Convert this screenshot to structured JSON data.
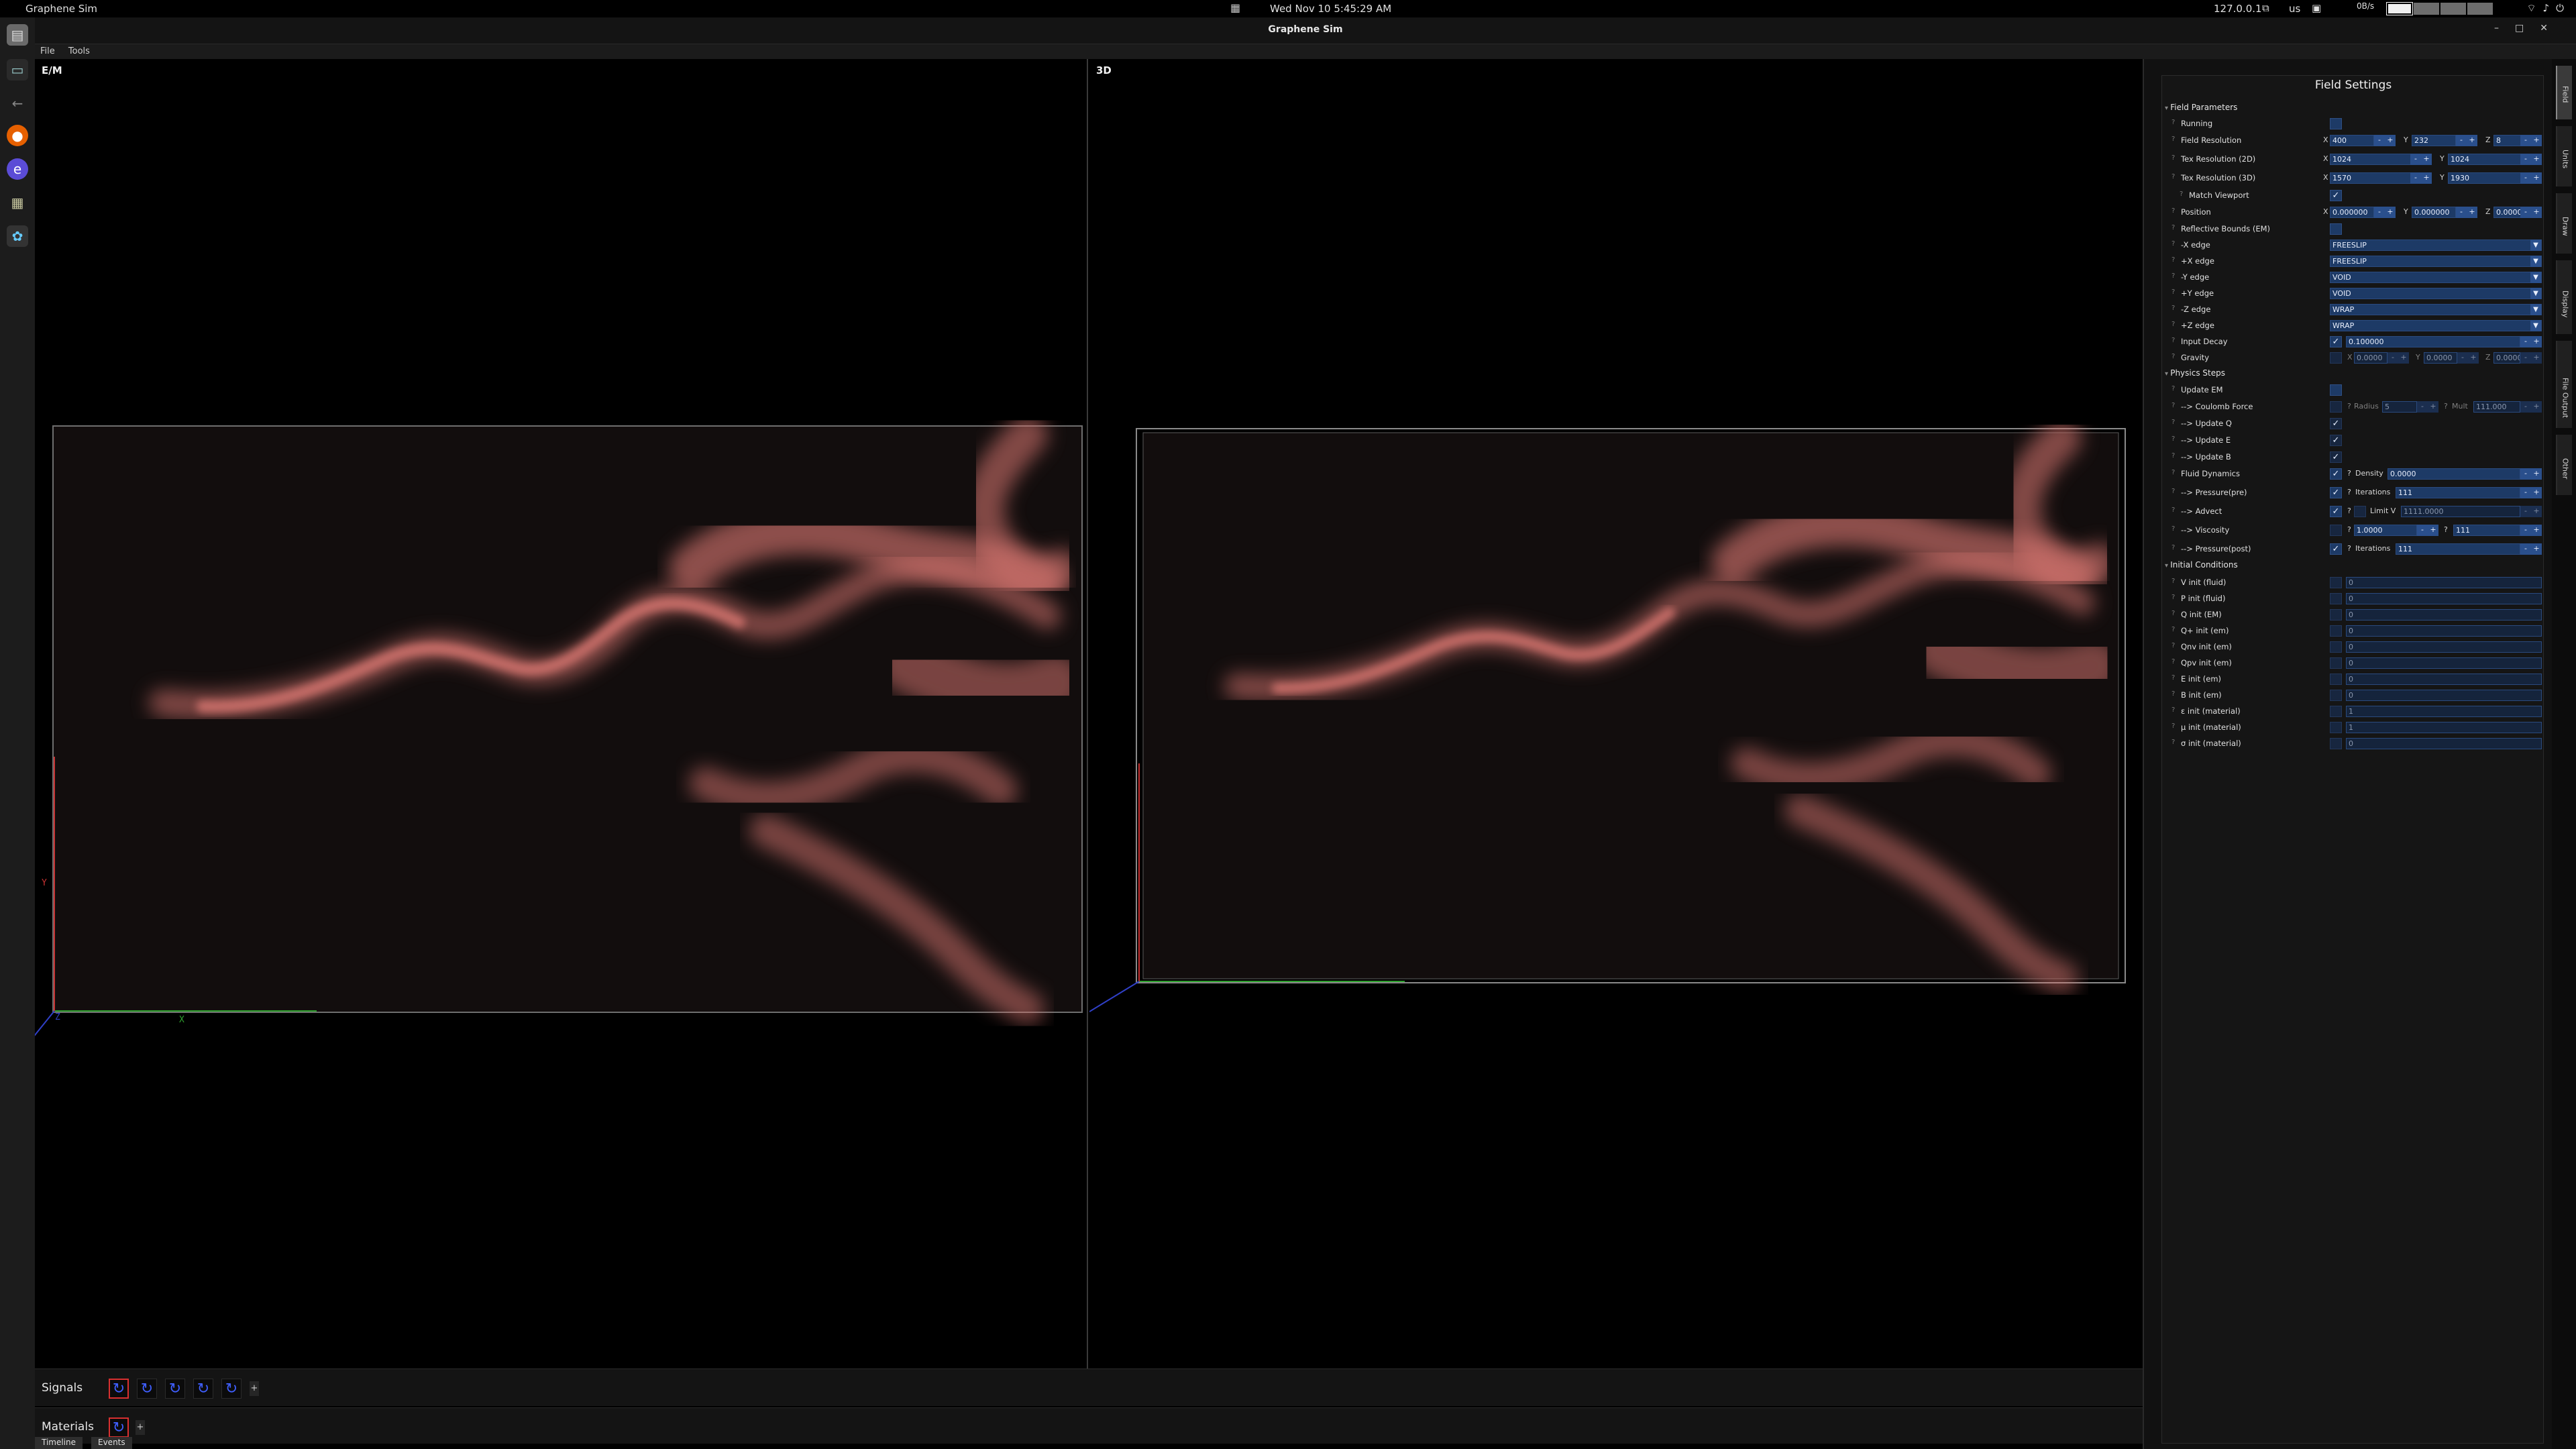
{
  "system": {
    "app_name": "Graphene Sim",
    "clock": "Wed Nov 10   5:45:29 AM",
    "ip": "127.0.0.1",
    "lang": "us",
    "net": "0B/s"
  },
  "window": {
    "title": "Graphene Sim",
    "menu": [
      "File",
      "Tools"
    ]
  },
  "viewports": {
    "em_label": "E/M",
    "d3_label": "3D",
    "em_axis_x": "X",
    "em_axis_y": "Y",
    "em_axis_z": "Z"
  },
  "bottom": {
    "signals_label": "Signals",
    "materials_label": "Materials",
    "add": "+",
    "tabs": [
      "Timeline",
      "Events"
    ]
  },
  "side_tabs": [
    "Field",
    "Units",
    "Draw",
    "Display",
    "File Output",
    "Other"
  ],
  "panel": {
    "title": "Field Settings",
    "sections": {
      "field_params": "Field Parameters",
      "physics_steps": "Physics Steps",
      "initial_conditions": "Initial Conditions"
    },
    "labels": {
      "running": "Running",
      "field_res": "Field Resolution",
      "tex_res_2d": "Tex Resolution (2D)",
      "tex_res_3d": "Tex Resolution (3D)",
      "match_viewport": "Match Viewport",
      "position": "Position",
      "reflective_bounds": "Reflective Bounds (EM)",
      "neg_x_edge": "-X edge",
      "pos_x_edge": "+X edge",
      "neg_y_edge": "-Y edge",
      "pos_y_edge": "+Y edge",
      "neg_z_edge": "-Z edge",
      "pos_z_edge": "+Z edge",
      "input_decay": "Input Decay",
      "gravity": "Gravity",
      "update_em": "Update EM",
      "coulomb": "--> Coulomb Force",
      "update_q": "--> Update Q",
      "update_e": "--> Update E",
      "update_b": "--> Update B",
      "fluid_dynamics": "Fluid Dynamics",
      "pressure_pre": "--> Pressure(pre)",
      "advect": "--> Advect",
      "viscosity": "--> Viscosity",
      "pressure_post": "--> Pressure(post)"
    },
    "values": {
      "field_res": {
        "x": "400",
        "y": "232",
        "z": "8"
      },
      "tex_res_2d": {
        "x": "1024",
        "y": "1024"
      },
      "tex_res_3d": {
        "x": "1570",
        "y": "1930"
      },
      "position": {
        "x": "0.000000",
        "y": "0.000000",
        "z": "0.000000"
      },
      "neg_x_edge": "FREESLIP",
      "pos_x_edge": "FREESLIP",
      "neg_y_edge": "VOID",
      "pos_y_edge": "VOID",
      "neg_z_edge": "WRAP",
      "pos_z_edge": "WRAP",
      "input_decay": "0.100000",
      "gravity": {
        "x": "0.0000",
        "y": "0.0000",
        "z": "0.0000"
      },
      "coulomb_radius_label": "Radius",
      "coulomb_radius": "5",
      "coulomb_mult_label": "Mult",
      "coulomb_mult": "111.000",
      "density_label": "Density",
      "density": "0.0000",
      "iterations_label": "Iterations",
      "pressure_pre_iterations": "111",
      "limit_v_label": "Limit V",
      "limit_v": "1111.0000",
      "viscosity": "1.0000",
      "viscosity_iter": "111",
      "pressure_post_iterations": "111"
    },
    "initial_conditions": [
      {
        "label": "V  init (fluid)",
        "value": "0"
      },
      {
        "label": "P  init (fluid)",
        "value": "0"
      },
      {
        "label": "Q  init (EM)",
        "value": "0"
      },
      {
        "label": "Q+ init (em)",
        "value": "0"
      },
      {
        "label": "Qnv init (em)",
        "value": "0"
      },
      {
        "label": "Qpv init (em)",
        "value": "0"
      },
      {
        "label": "E  init (em)",
        "value": "0"
      },
      {
        "label": "B  init (em)",
        "value": "0"
      },
      {
        "label": "ε  init (material)",
        "value": "1"
      },
      {
        "label": "μ  init (material)",
        "value": "1"
      },
      {
        "label": "σ  init (material)",
        "value": "0"
      }
    ]
  },
  "colors": {
    "accent": "#1d3a66",
    "fluid": "#e07a74",
    "axis_x": "#2ea02e",
    "axis_y": "#c83232",
    "axis_z": "#3040c8"
  },
  "icons": {
    "dock": [
      "files-icon",
      "terminal-icon",
      "back-arrow-icon",
      "firefox-icon",
      "app-icon",
      "gpu-icon",
      "graphene-icon"
    ]
  }
}
